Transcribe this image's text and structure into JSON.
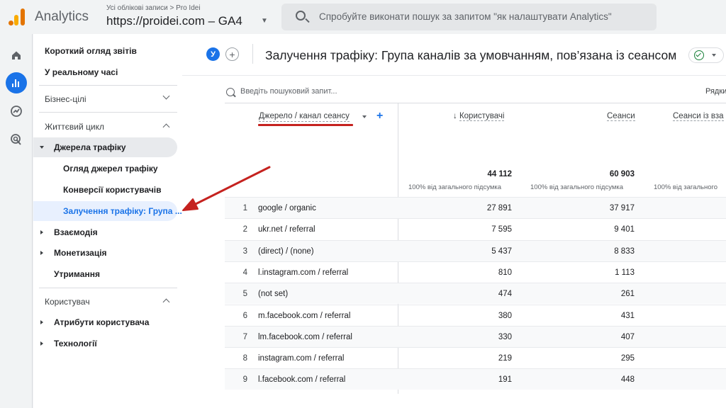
{
  "header": {
    "app_name": "Analytics",
    "breadcrumb": "Усі облікові записи > Pro Idei",
    "property": "https://proidei.com – GA4",
    "search_placeholder": "Спробуйте виконати пошук за запитом \"як налаштувати Analytics\""
  },
  "rail": {
    "icons": [
      "home-icon",
      "reports-icon",
      "explore-icon",
      "advertising-icon"
    ],
    "active": "reports-icon"
  },
  "nav": {
    "overview": "Короткий огляд звітів",
    "realtime": "У реальному часі",
    "business_goals": "Бізнес-цілі",
    "lifecycle": "Життєвий цикл",
    "acquisition": "Джерела трафіку",
    "acq_overview": "Огляд джерел трафіку",
    "user_acq": "Конверсії користувачів",
    "traffic_acq": "Залучення трафіку: Група ...",
    "engagement": "Взаємодія",
    "monetization": "Монетизація",
    "retention": "Утримання",
    "user": "Користувач",
    "user_attributes": "Атрибути користувача",
    "tech": "Технології"
  },
  "report": {
    "avatar": "У",
    "title": "Залучення трафіку: Група каналів за умовчанням, пов’язана із сеансом",
    "table_search": "Введіть пошуковий запит...",
    "rows_label": "Рядки",
    "dimension_header": "Джерело / канал сеансу",
    "metrics": [
      {
        "label": "Користувачі",
        "sort": "↓",
        "total": "44 112",
        "pct": "100% від загального підсумка"
      },
      {
        "label": "Сеанси",
        "sort": "",
        "total": "60 903",
        "pct": "100% від загального підсумка"
      },
      {
        "label": "Сеанси із вза",
        "sort": "",
        "total": "",
        "pct": "100% від загального"
      }
    ],
    "rows": [
      {
        "n": "1",
        "dim": "google / organic",
        "users": "27 891",
        "sessions": "37 917"
      },
      {
        "n": "2",
        "dim": "ukr.net / referral",
        "users": "7 595",
        "sessions": "9 401"
      },
      {
        "n": "3",
        "dim": "(direct) / (none)",
        "users": "5 437",
        "sessions": "8 833"
      },
      {
        "n": "4",
        "dim": "l.instagram.com / referral",
        "users": "810",
        "sessions": "1 113"
      },
      {
        "n": "5",
        "dim": "(not set)",
        "users": "474",
        "sessions": "261"
      },
      {
        "n": "6",
        "dim": "m.facebook.com / referral",
        "users": "380",
        "sessions": "431"
      },
      {
        "n": "7",
        "dim": "lm.facebook.com / referral",
        "users": "330",
        "sessions": "407"
      },
      {
        "n": "8",
        "dim": "instagram.com / referral",
        "users": "219",
        "sessions": "295"
      },
      {
        "n": "9",
        "dim": "l.facebook.com / referral",
        "users": "191",
        "sessions": "448"
      }
    ]
  },
  "colors": {
    "accent": "#1a73e8",
    "annotation_red": "#c5221f",
    "logo_orange": "#e37400",
    "logo_yellow": "#f9ab00"
  }
}
